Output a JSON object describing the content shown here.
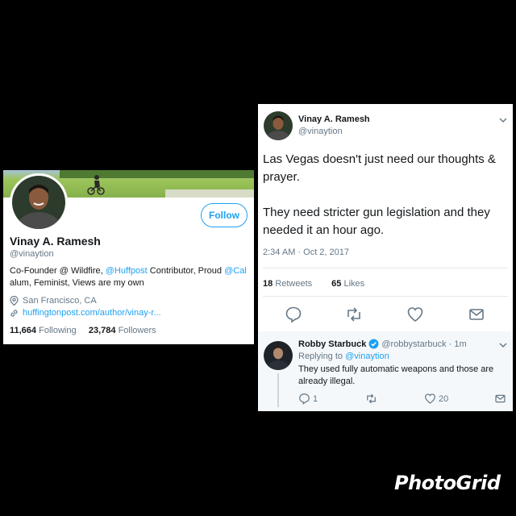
{
  "profile": {
    "name": "Vinay A. Ramesh",
    "handle": "@vinaytion",
    "follow_label": "Follow",
    "bio": {
      "part1": "Co-Founder @ Wildfire, ",
      "link1": "@Huffpost",
      "part2": " Contributor, Proud ",
      "link2": "@Cal",
      "part3": " alum, Feminist, Views are my own"
    },
    "location": "San Francisco, CA",
    "url": "huffingtonpost.com/author/vinay-r...",
    "following_count": "11,664",
    "following_label": "Following",
    "followers_count": "23,784",
    "followers_label": "Followers"
  },
  "tweet": {
    "name": "Vinay A. Ramesh",
    "handle": "@vinaytion",
    "paragraph1": "Las Vegas doesn't just need our thoughts & prayer.",
    "paragraph2": "They need stricter gun legislation and they needed it an hour ago.",
    "timestamp": "2:34 AM · Oct 2, 2017",
    "retweets_count": "18",
    "retweets_label": "Retweets",
    "likes_count": "65",
    "likes_label": "Likes"
  },
  "reply": {
    "name": "Robby Starbuck",
    "handle": "@robbystarbuck",
    "time": "· 1m",
    "replying_prefix": "Replying to",
    "replying_to": "@vinaytion",
    "text": "They used fully automatic weapons and those are already illegal.",
    "reply_count": "1",
    "like_count": "20"
  },
  "watermark": "PhotoGrid",
  "colors": {
    "accent": "#1da1f2",
    "muted": "#657786",
    "text": "#14171a",
    "background": "#000000"
  },
  "icons": [
    "location-icon",
    "link-icon",
    "reply-icon",
    "retweet-icon",
    "like-icon",
    "dm-icon",
    "chevron-down-icon",
    "verified-badge-icon"
  ]
}
